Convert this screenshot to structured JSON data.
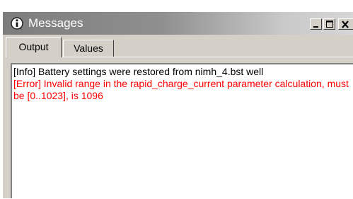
{
  "window": {
    "title": "Messages",
    "icon": "info-icon"
  },
  "titlebar_buttons": {
    "minimize": "minimize-icon",
    "maximize": "maximize-icon",
    "close": "close-icon"
  },
  "tabs": [
    {
      "label": "Output",
      "selected": true
    },
    {
      "label": "Values",
      "selected": false
    }
  ],
  "log": [
    {
      "level": "info",
      "text": "[Info] Battery settings were restored from nimh_4.bst well"
    },
    {
      "level": "error",
      "text": "[Error] Invalid range in the rapid_charge_current parameter calculation, must be [0..1023], is 1096"
    }
  ],
  "colors": {
    "info_text": "#000000",
    "error_text": "#ff0000"
  }
}
